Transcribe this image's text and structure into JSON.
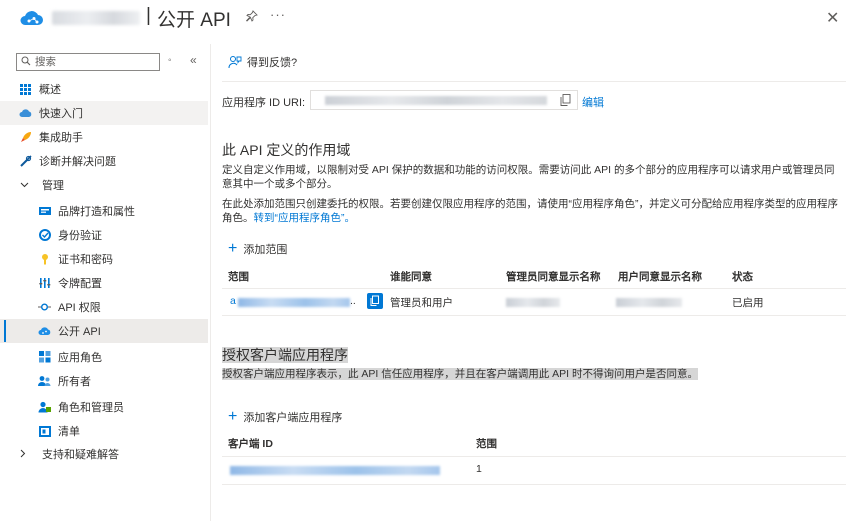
{
  "header": {
    "title_separator": "|",
    "title": "公开 API",
    "pin": "pin-icon",
    "more": "···",
    "close": "✕"
  },
  "sidebar": {
    "search_placeholder": "搜索",
    "items": [
      {
        "label": "概述",
        "icon": "overview-grid-icon"
      },
      {
        "label": "快速入门",
        "icon": "quickstart-cloud-icon"
      },
      {
        "label": "集成助手",
        "icon": "rocket-icon"
      },
      {
        "label": "诊断并解决问题",
        "icon": "wrench-icon"
      },
      {
        "label": "管理",
        "group": true,
        "expanded": true
      },
      {
        "label": "品牌打造和属性",
        "icon": "branding-icon"
      },
      {
        "label": "身份验证",
        "icon": "authentication-icon"
      },
      {
        "label": "证书和密码",
        "icon": "key-icon"
      },
      {
        "label": "令牌配置",
        "icon": "token-icon"
      },
      {
        "label": "API 权限",
        "icon": "api-permissions-icon"
      },
      {
        "label": "公开 API",
        "icon": "expose-api-cloud-icon",
        "selected": true
      },
      {
        "label": "应用角色",
        "icon": "app-roles-icon"
      },
      {
        "label": "所有者",
        "icon": "owners-icon"
      },
      {
        "label": "角色和管理员",
        "icon": "roles-admins-icon"
      },
      {
        "label": "清单",
        "icon": "manifest-icon"
      },
      {
        "label": "支持和疑难解答",
        "group": true,
        "expanded": false
      }
    ]
  },
  "main": {
    "feedback_label": "得到反馈?",
    "uri_label": "应用程序 ID URI:",
    "edit_label": "编辑",
    "scopes_title": "此 API 定义的作用域",
    "scopes_desc": "定义自定义作用域，以限制对受 API 保护的数据和功能的访问权限。需要访问此 API 的多个部分的应用程序可以请求用户或管理员同意其中一个或多个部分。",
    "scopes_note_prefix": "在此处添加范围只创建委托的权限。若要创建仅限应用程序的范围，请使用“应用程序角色”，并定义可分配给应用程序类型的应用程序角色。",
    "scopes_note_link": "转到“应用程序角色”。",
    "add_scope_label": "添加范围",
    "scopes_table": {
      "headers": [
        "范围",
        "谁能同意",
        "管理员同意显示名称",
        "用户同意显示名称",
        "状态"
      ],
      "rows": [
        {
          "scope_prefix": "a",
          "scope_ellipsis": "..",
          "who_can_consent": "管理员和用户",
          "status": "已启用"
        }
      ]
    },
    "clients_title": "授权客户端应用程序",
    "clients_desc": "授权客户端应用程序表示，此 API 信任应用程序，并且在客户端调用此 API 时不得询问用户是否同意。",
    "add_client_label": "添加客户端应用程序",
    "clients_table": {
      "headers": [
        "客户端 ID",
        "范围"
      ],
      "rows": [
        {
          "scope_count": "1"
        }
      ]
    }
  },
  "colors": {
    "accent": "#0078d4",
    "selected_bg": "#edebe9",
    "highlight_bg": "#d6d6d6"
  }
}
